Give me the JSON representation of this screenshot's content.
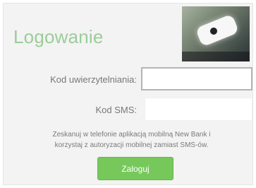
{
  "login": {
    "title": "Logowanie",
    "fields": {
      "code_label": "Kod uwierzytelniania:",
      "code_value": "",
      "code_placeholder": "",
      "sms_label": "Kod SMS:",
      "sms_value": "",
      "sms_placeholder": ""
    },
    "info_lines": [
      "Zeskanuj w telefonie aplikacją mobilną New Bank i",
      "korzystaj z autoryzacji mobilnej zamiast SMS-ów."
    ],
    "submit_label": "Zaloguj"
  },
  "colors": {
    "title": "#9ccc9a",
    "button": "#76c85a",
    "panel": "#f3f3f3"
  }
}
